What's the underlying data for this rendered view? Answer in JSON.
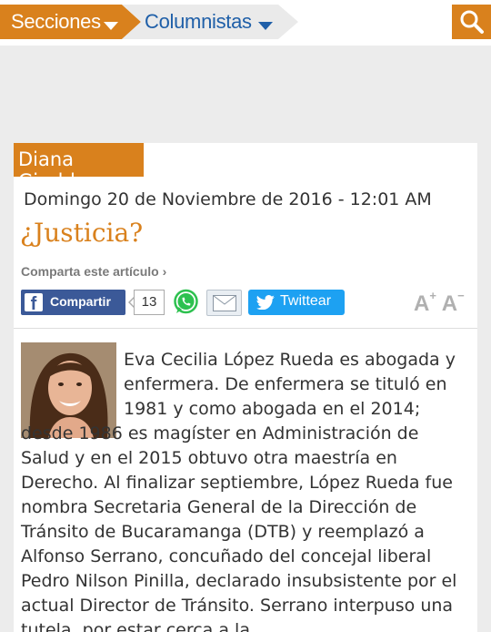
{
  "nav": {
    "secciones_label": "Secciones",
    "columnistas_label": "Columnistas"
  },
  "colors": {
    "accent": "#d9811d",
    "link_blue": "#1f5fa8",
    "facebook": "#3b5998",
    "twitter": "#1da1f2",
    "whatsapp": "#2dc14f"
  },
  "article": {
    "author": "Diana Giraldo",
    "date": "Domingo 20 de Noviembre de 2016 - 12:01 AM",
    "title": "¿Justicia?",
    "share_label": "Comparta este artículo ›",
    "share": {
      "facebook_label": "Compartir",
      "share_count": "13",
      "twitter_label": "Twittear"
    },
    "font_increase": "A",
    "font_increase_sign": "+",
    "font_decrease": "A",
    "font_decrease_sign": "−",
    "body": "Eva Cecilia López Rueda es abogada y enfermera. De enfermera se tituló en 1981 y como abogada en el 2014; desde 1986 es magíster en Administración de Salud y en el 2015 obtuvo otra maestría en Derecho. Al finalizar septiembre, López Rueda fue nombra Secretaria General de la Dirección de Tránsito de Bucaramanga (DTB) y reemplazó a Alfonso Serrano, concuñado del concejal liberal Pedro Nilson Pinilla, declarado insubsistente por el actual Director de Tránsito. Serrano interpuso una tutela, por estar cerca a la"
  }
}
